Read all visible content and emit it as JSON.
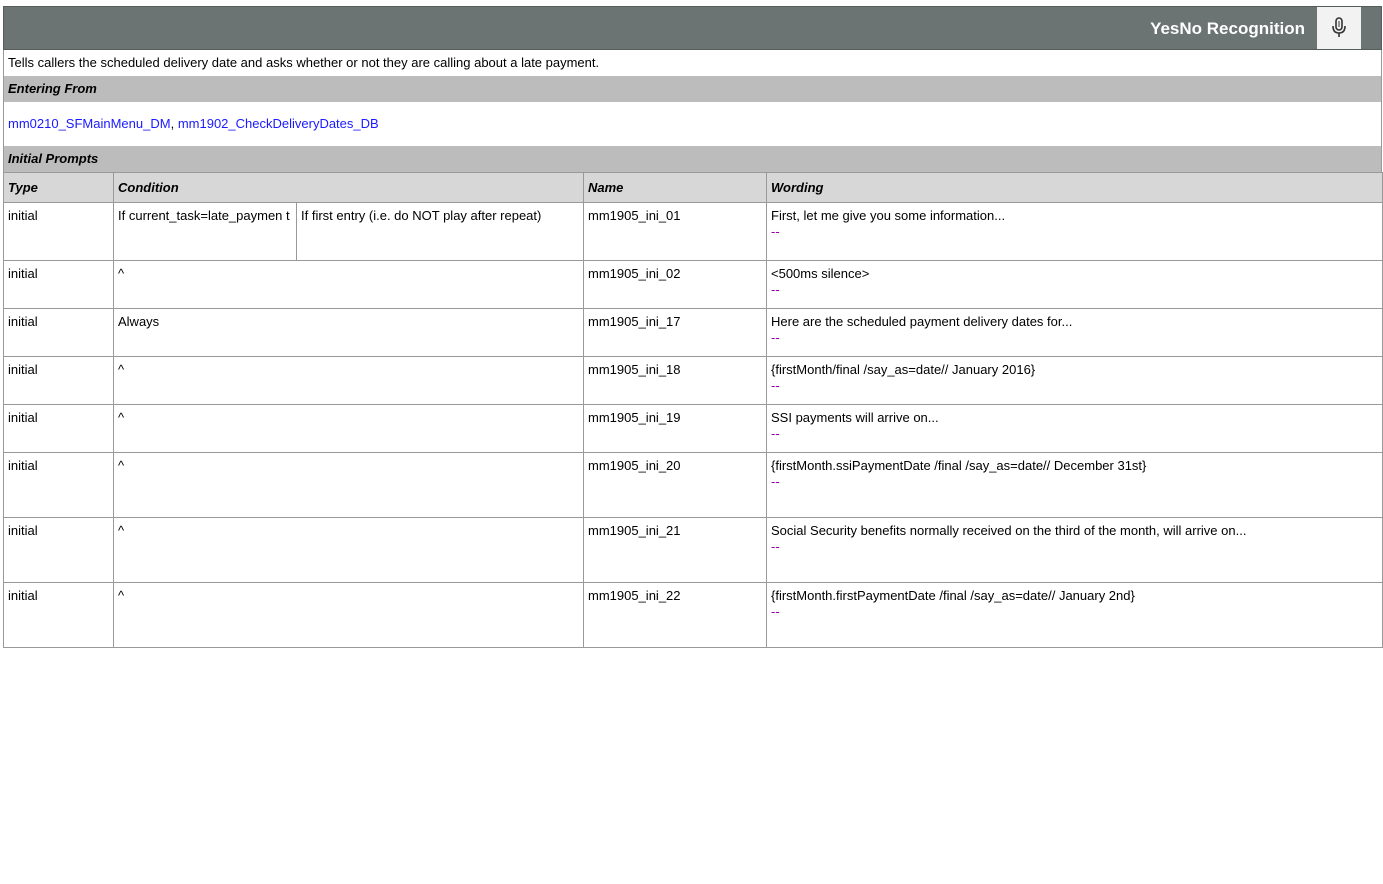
{
  "header": {
    "title": "YesNo Recognition",
    "icon": "microphone-icon"
  },
  "description": "Tells callers the scheduled delivery date and asks whether or not they are calling about a late payment.",
  "entering_from": {
    "label": "Entering From",
    "links": [
      "mm0210_SFMainMenu_DM",
      "mm1902_CheckDeliveryDates_DB"
    ],
    "separator": ","
  },
  "initial_prompts": {
    "label": "Initial Prompts",
    "columns": {
      "type": "Type",
      "condition": "Condition",
      "name": "Name",
      "wording": "Wording"
    },
    "rows": [
      {
        "type": "initial",
        "cond1": "If current_task=late_paymen t",
        "cond2": "If first entry (i.e. do NOT play after repeat)",
        "name": "mm1905_ini_01",
        "wording": "First, let me give you some information...",
        "dash": "--"
      },
      {
        "type": "initial",
        "cond": "^",
        "name": "mm1905_ini_02",
        "wording": "<500ms silence>",
        "dash": "--"
      },
      {
        "type": "initial",
        "cond": "Always",
        "name": "mm1905_ini_17",
        "wording": "Here are the scheduled payment delivery dates for...",
        "dash": "--"
      },
      {
        "type": "initial",
        "cond": "^",
        "name": "mm1905_ini_18",
        "wording": "{firstMonth/final /say_as=date// January 2016}",
        "dash": "--"
      },
      {
        "type": "initial",
        "cond": "^",
        "name": "mm1905_ini_19",
        "wording": "SSI payments will arrive on...",
        "dash": "--"
      },
      {
        "type": "initial",
        "cond": "^",
        "name": "mm1905_ini_20",
        "wording": "{firstMonth.ssiPaymentDate /final /say_as=date// December 31st}",
        "dash": "--"
      },
      {
        "type": "initial",
        "cond": "^",
        "name": "mm1905_ini_21",
        "wording": "Social Security benefits normally received on the third of the month, will arrive on...",
        "dash": "--"
      },
      {
        "type": "initial",
        "cond": "^",
        "name": "mm1905_ini_22",
        "wording": "{firstMonth.firstPaymentDate /final /say_as=date// January 2nd}",
        "dash": "--"
      }
    ]
  }
}
